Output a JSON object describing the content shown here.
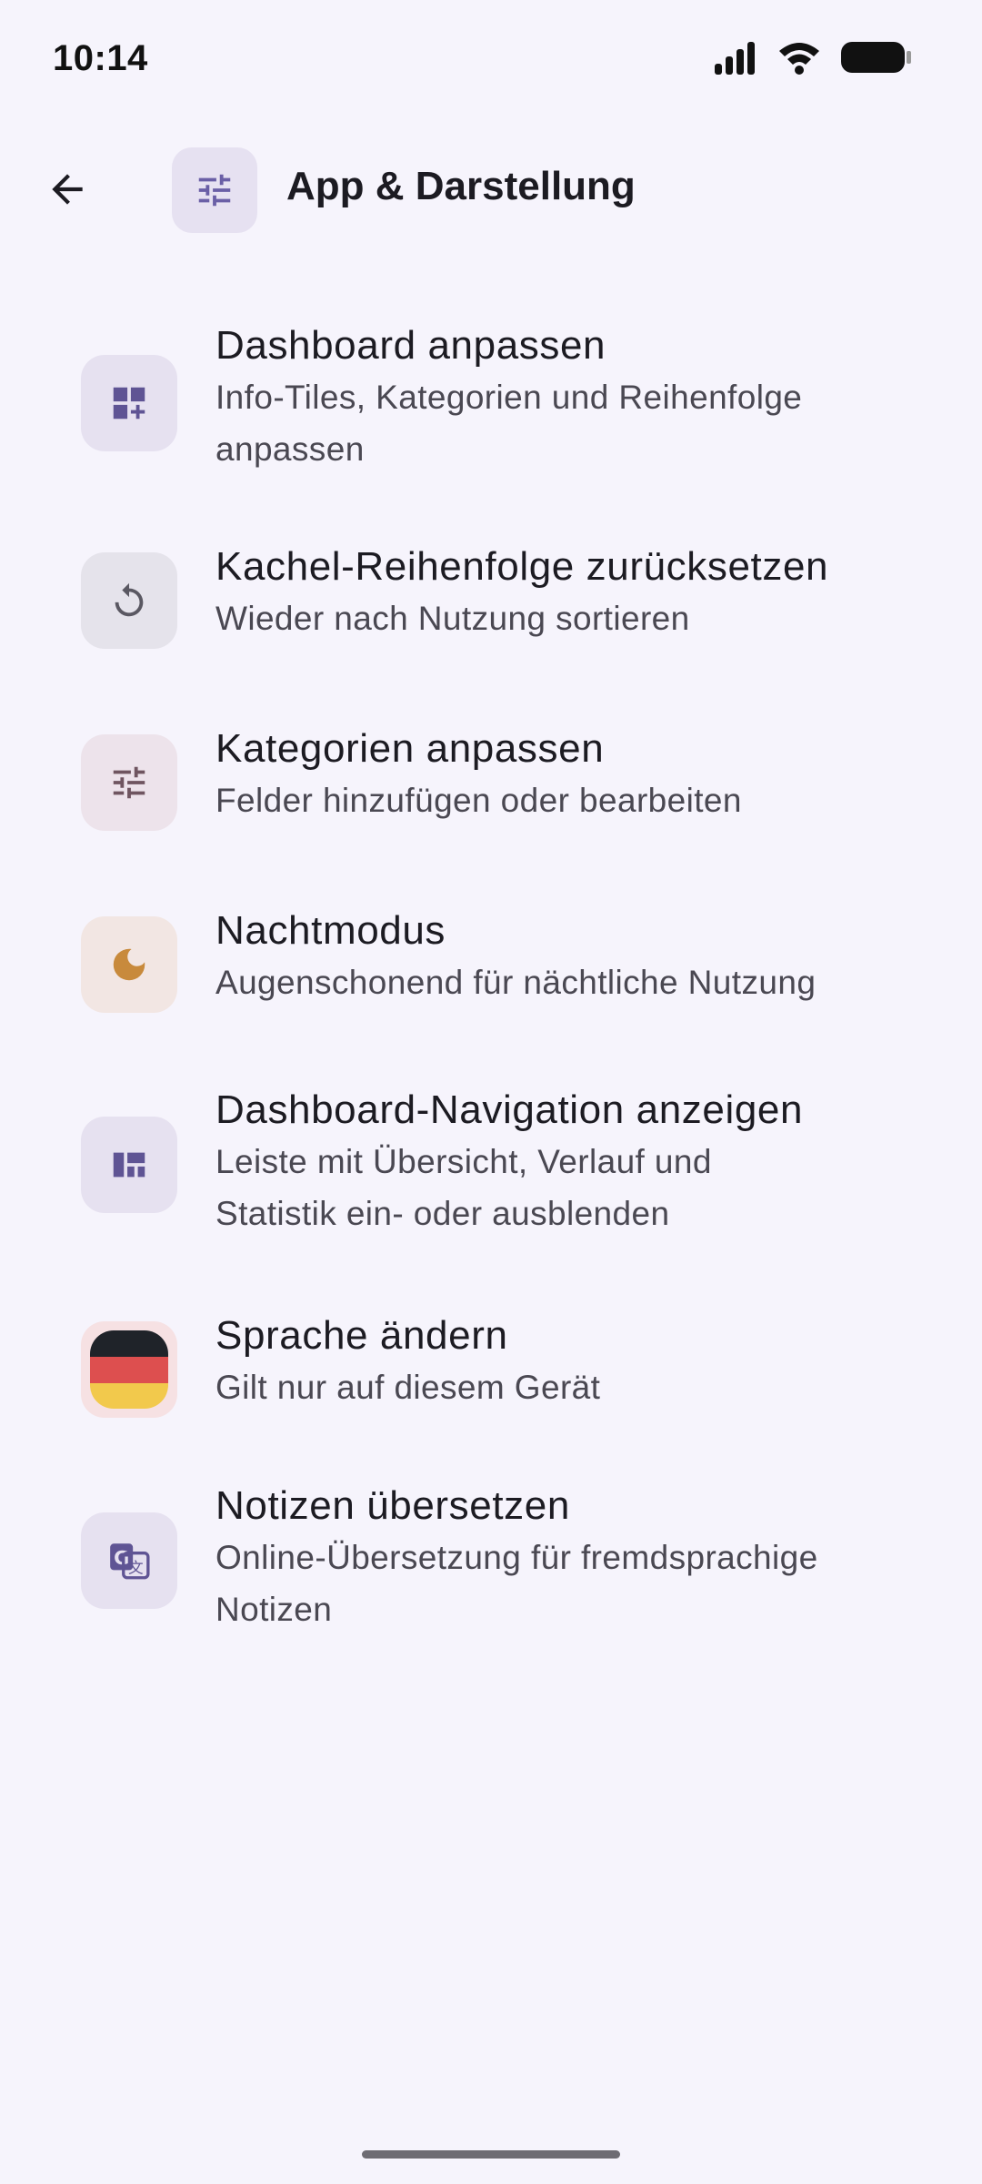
{
  "status_bar": {
    "time": "10:14",
    "icons": [
      "signal-icon",
      "wifi-icon",
      "battery-icon"
    ]
  },
  "app_bar": {
    "back_icon": "arrow-left-icon",
    "title_icon": "tune-icon",
    "title": "App & Darstellung"
  },
  "items": [
    {
      "title": "Dashboard anpassen",
      "subtitle_line1": "Info-Tiles, Kategorien und Reihenfolge",
      "subtitle_line2": "anpassen",
      "icon": "dashboard-customize-icon",
      "icon_bg": "#E6E1F0",
      "icon_color": "#5F5494"
    },
    {
      "title": "Kachel-Reihenfolge zurücksetzen",
      "subtitle_line1": "Wieder nach Nutzung sortieren",
      "icon": "reset-icon",
      "icon_bg": "#E5E3EB",
      "icon_color": "#5A5862"
    },
    {
      "title": "Kategorien anpassen",
      "subtitle_line1": "Felder hinzufügen oder bearbeiten",
      "icon": "tune-icon",
      "icon_bg": "#EDE3EB",
      "icon_color": "#6F5560"
    },
    {
      "title": "Nachtmodus",
      "subtitle_line1": "Augenschonend für nächtliche Nutzung",
      "icon": "moon-icon",
      "icon_bg": "#F2E6E3",
      "icon_color": "#C88A3C"
    },
    {
      "title": "Dashboard-Navigation anzeigen",
      "subtitle_line1": "Leiste mit Übersicht, Verlauf und",
      "subtitle_line2": "Statistik ein- oder ausblenden",
      "icon": "dashboard-layout-icon",
      "icon_bg": "#E6E1F0",
      "icon_color": "#5F5494"
    },
    {
      "title": "Sprache ändern",
      "subtitle_line1": "Gilt nur auf diesem Gerät",
      "icon": "german-flag-icon",
      "icon_bg": "#F6E1E3"
    },
    {
      "title": "Notizen übersetzen",
      "subtitle_line1": "Online-Übersetzung für fremdsprachige",
      "subtitle_line2": "Notizen",
      "icon": "translate-icon",
      "icon_bg": "#E6E1F0",
      "icon_color": "#5F5494"
    }
  ]
}
